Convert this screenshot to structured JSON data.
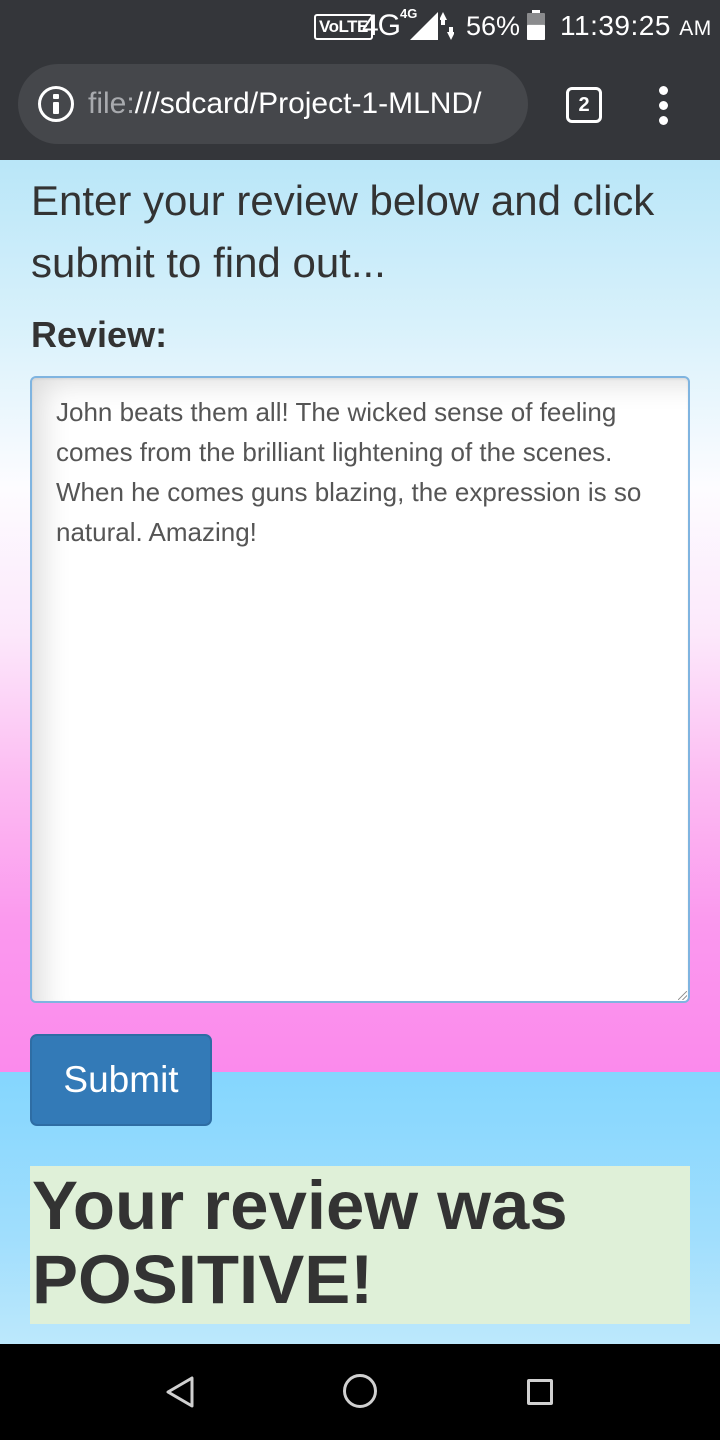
{
  "status_bar": {
    "volte": "VoLTE",
    "network": "4G",
    "network_small": "4G",
    "battery_percent": "56%",
    "battery_level": 0.56,
    "time": "11:39:25",
    "ampm": "AM"
  },
  "browser": {
    "url_scheme": "file:",
    "url_rest": "///sdcard/Project-1-MLND/",
    "tab_count": "2"
  },
  "page": {
    "intro": "Enter your review below and click submit to find out...",
    "review_label": "Review:",
    "review_text": "John beats them all! The wicked sense of feeling comes from the brilliant lightening of the scenes. When he comes guns blazing, the expression is so natural. Amazing!",
    "submit_label": "Submit",
    "result_text": "Your review was POSITIVE!"
  },
  "colors": {
    "submit_button": "#337ab7",
    "result_background": "#dff0d8",
    "chrome_toolbar": "#34363a"
  }
}
